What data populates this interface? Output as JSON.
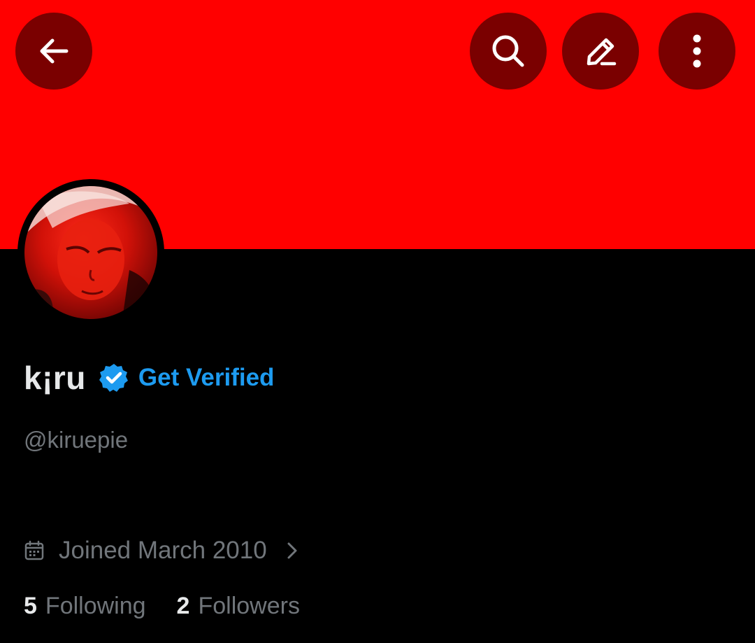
{
  "colors": {
    "banner": "#ff0000",
    "page_background": "#000000",
    "header_button_background": "#7a0000",
    "accent_blue": "#1d9bf0",
    "primary_text": "#e7e9ea",
    "secondary_text": "#71767b"
  },
  "header": {
    "back_icon": "arrow-left-icon",
    "search_icon": "search-icon",
    "edit_icon": "pencil-icon",
    "more_icon": "more-vertical-icon"
  },
  "profile": {
    "display_name": "k¡ru",
    "verified_badge_icon": "verified-badge-icon",
    "get_verified_label": "Get Verified",
    "handle": "@kiruepie",
    "calendar_icon": "calendar-icon",
    "joined_text": "Joined March 2010",
    "joined_chevron_icon": "chevron-right-icon"
  },
  "stats": {
    "following_count": "5",
    "following_label": "Following",
    "followers_count": "2",
    "followers_label": "Followers"
  }
}
